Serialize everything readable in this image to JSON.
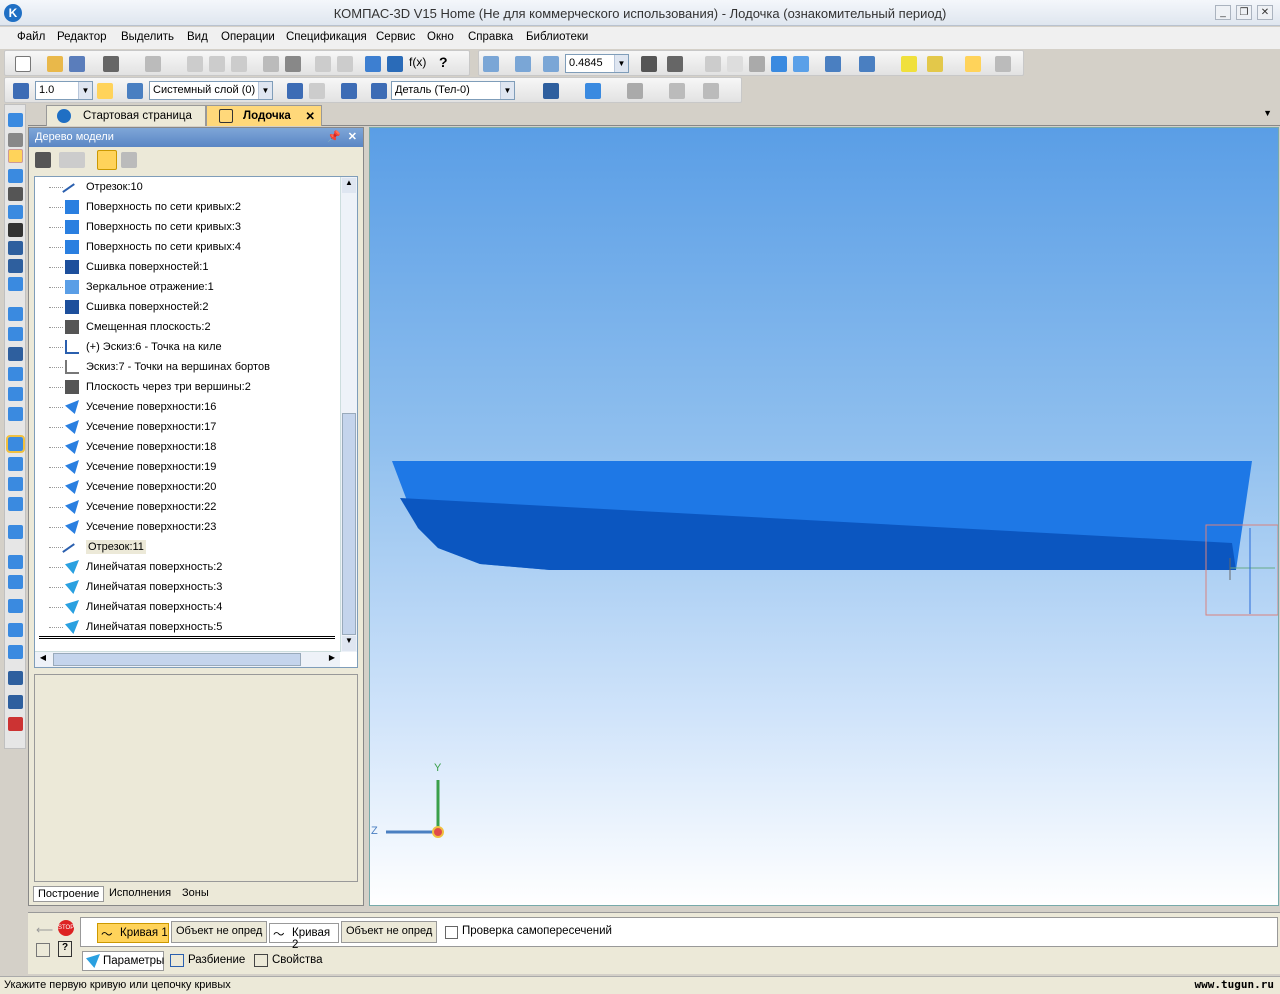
{
  "titlebar": {
    "title": "КОМПАС-3D V15 Home (Не для коммерческого использования) - Лодочка (ознакомительный период)"
  },
  "menu": [
    "Файл",
    "Редактор",
    "Выделить",
    "Вид",
    "Операции",
    "Спецификация",
    "Сервис",
    "Окно",
    "Справка",
    "Библиотеки"
  ],
  "toolbar": {
    "zoom_value": "0.4845",
    "step_value": "1.0",
    "layer_value": "Системный слой (0)",
    "detail_value": "Деталь (Тел-0)"
  },
  "doc_tabs": [
    {
      "label": "Стартовая страница",
      "active": false
    },
    {
      "label": "Лодочка",
      "active": true
    }
  ],
  "tree": {
    "title": "Дерево модели",
    "items": [
      {
        "label": "Отрезок:10",
        "icon": "segment-icon"
      },
      {
        "label": "Поверхность по сети кривых:2",
        "icon": "surface-mesh-icon"
      },
      {
        "label": "Поверхность по сети кривых:3",
        "icon": "surface-mesh-icon"
      },
      {
        "label": "Поверхность по сети кривых:4",
        "icon": "surface-mesh-icon"
      },
      {
        "label": "Сшивка поверхностей:1",
        "icon": "stitch-icon"
      },
      {
        "label": "Зеркальное отражение:1",
        "icon": "mirror-icon"
      },
      {
        "label": "Сшивка поверхностей:2",
        "icon": "stitch-icon"
      },
      {
        "label": "Смещенная плоскость:2",
        "icon": "plane-icon"
      },
      {
        "label": "(+) Эскиз:6 - Точка на киле",
        "icon": "sketch-icon"
      },
      {
        "label": "Эскиз:7 - Точки на вершинах бортов",
        "icon": "sketch-icon"
      },
      {
        "label": "Плоскость через три вершины:2",
        "icon": "plane-icon"
      },
      {
        "label": "Усечение поверхности:16",
        "icon": "trim-icon"
      },
      {
        "label": "Усечение поверхности:17",
        "icon": "trim-icon"
      },
      {
        "label": "Усечение поверхности:18",
        "icon": "trim-icon"
      },
      {
        "label": "Усечение поверхности:19",
        "icon": "trim-icon"
      },
      {
        "label": "Усечение поверхности:20",
        "icon": "trim-icon"
      },
      {
        "label": "Усечение поверхности:22",
        "icon": "trim-icon"
      },
      {
        "label": "Усечение поверхности:23",
        "icon": "trim-icon"
      },
      {
        "label": "Отрезок:11",
        "icon": "segment-icon"
      },
      {
        "label": "Линейчатая поверхность:2",
        "icon": "ruled-icon"
      },
      {
        "label": "Линейчатая поверхность:3",
        "icon": "ruled-icon"
      },
      {
        "label": "Линейчатая поверхность:4",
        "icon": "ruled-icon"
      },
      {
        "label": "Линейчатая поверхность:5",
        "icon": "ruled-icon"
      }
    ],
    "bottom_tabs": [
      "Построение",
      "Исполнения",
      "Зоны"
    ]
  },
  "axes": {
    "y": "Y",
    "z": "Z"
  },
  "props": {
    "curve1_label": "Кривая 1",
    "curve1_value": "Объект не опред",
    "curve2_label": "Кривая 2",
    "curve2_value": "Объект не опред",
    "self_intersect_label": "Проверка самопересечений",
    "tabs": [
      "Параметры",
      "Разбиение",
      "Свойства"
    ]
  },
  "status": {
    "text": "Укажите первую кривую или цепочку кривых",
    "watermark": "www.tugun.ru"
  }
}
